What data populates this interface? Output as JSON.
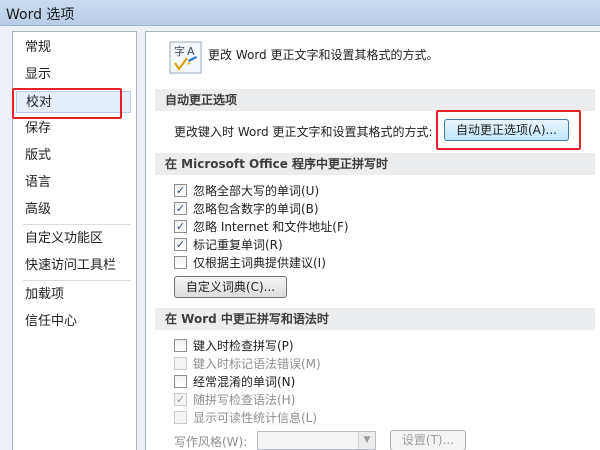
{
  "window": {
    "title": "Word 选项"
  },
  "sidebar": {
    "items": [
      {
        "label": "常规"
      },
      {
        "label": "显示"
      },
      {
        "label": "校对"
      },
      {
        "label": "保存"
      },
      {
        "label": "版式"
      },
      {
        "label": "语言"
      },
      {
        "label": "高级"
      },
      {
        "label": "自定义功能区"
      },
      {
        "label": "快速访问工具栏"
      },
      {
        "label": "加载项"
      },
      {
        "label": "信任中心"
      }
    ],
    "selected": "校对"
  },
  "main": {
    "header_icon": "spell-check-icon",
    "header_text": "更改 Word 更正文字和设置其格式的方式。",
    "autocorrect_section": {
      "title": "自动更正选项",
      "description": "更改键入时 Word 更正文字和设置其格式的方式:",
      "button_label": "自动更正选项(A)..."
    },
    "office_section": {
      "title": "在 Microsoft Office 程序中更正拼写时",
      "options": [
        {
          "label": "忽略全部大写的单词(U)",
          "checked": true
        },
        {
          "label": "忽略包含数字的单词(B)",
          "checked": true
        },
        {
          "label": "忽略 Internet 和文件地址(F)",
          "checked": true
        },
        {
          "label": "标记重复单词(R)",
          "checked": true
        },
        {
          "label": "仅根据主词典提供建议(I)",
          "checked": false
        }
      ],
      "custom_dict_button": "自定义词典(C)..."
    },
    "word_section": {
      "title": "在 Word 中更正拼写和语法时",
      "options": [
        {
          "label": "键入时检查拼写(P)",
          "checked": false,
          "enabled": true
        },
        {
          "label": "键入时标记语法错误(M)",
          "checked": false,
          "enabled": false
        },
        {
          "label": "经常混淆的单词(N)",
          "checked": false,
          "enabled": true
        },
        {
          "label": "随拼写检查语法(H)",
          "checked": true,
          "enabled": false
        },
        {
          "label": "显示可读性统计信息(L)",
          "checked": false,
          "enabled": false
        }
      ],
      "writing_style_label": "写作风格(W):",
      "writing_style_value": "",
      "settings_button": "设置(T)..."
    }
  },
  "colors": {
    "highlight_box": "#e8202a",
    "checkmark": "#2b4d7e"
  }
}
